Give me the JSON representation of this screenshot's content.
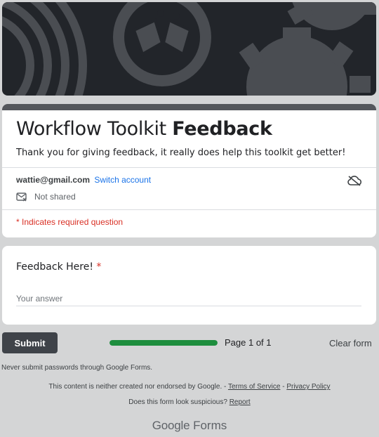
{
  "form": {
    "title_regular": "Workflow Toolkit ",
    "title_bold": "Feedback",
    "description": "Thank you for giving feedback, it really does help this toolkit get better!",
    "account_email": "wattie@gmail.com",
    "switch_account": "Switch account",
    "not_shared": "Not shared",
    "required_note": "* Indicates required question"
  },
  "question": {
    "label": "Feedback Here!",
    "required_star": "*",
    "placeholder": "Your answer",
    "value": ""
  },
  "footer": {
    "submit_label": "Submit",
    "progress": 1.0,
    "page_label": "Page 1 of 1",
    "clear_label": "Clear form",
    "never_submit": "Never submit passwords through Google Forms.",
    "disclaimer_prefix": "This content is neither created nor endorsed by Google. - ",
    "terms_link": "Terms of Service",
    "separator": " - ",
    "privacy_link": "Privacy Policy",
    "suspicious_prefix": "Does this form look suspicious? ",
    "report_link": "Report",
    "brand_google": "Google",
    "brand_forms": "Forms"
  },
  "colors": {
    "banner": "#22252a",
    "accent_bar": "#54575c",
    "progress_fill": "#1e8e3e",
    "required": "#d93025",
    "link": "#1a73e8",
    "submit_bg": "#3f4349"
  },
  "icons": {
    "cloud": "cloud-off-icon",
    "mail": "mail-not-shared-icon"
  }
}
